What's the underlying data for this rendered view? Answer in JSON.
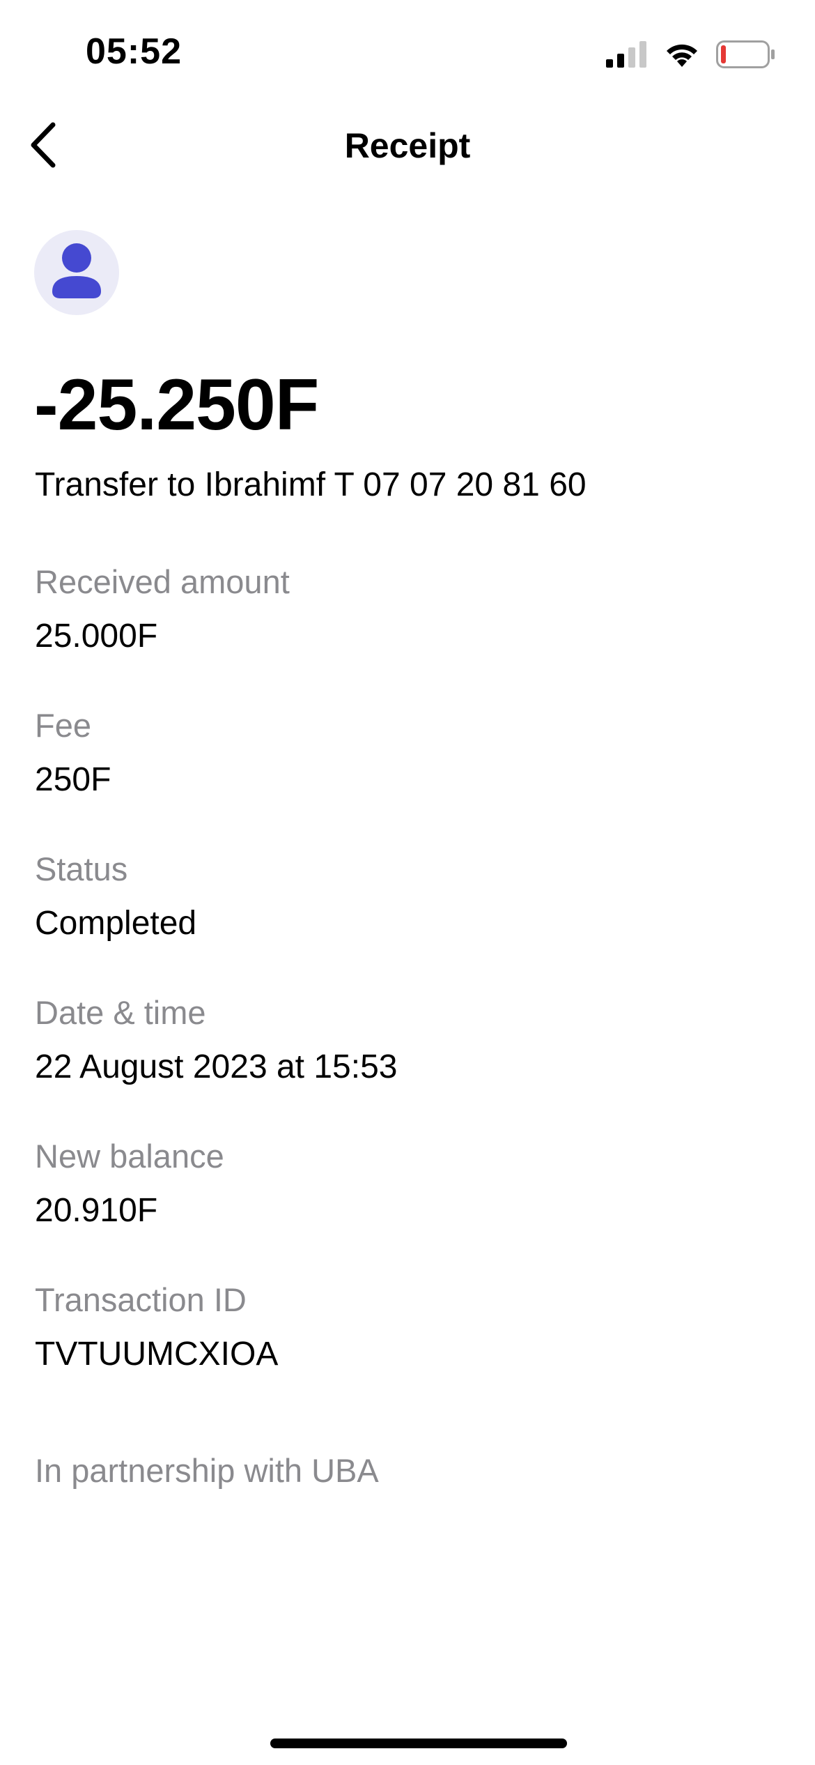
{
  "status_bar": {
    "time": "05:52",
    "signal_icon": "cellular-signal-icon",
    "wifi_icon": "wifi-icon",
    "battery_icon": "battery-low-icon",
    "battery_color": "#e53935"
  },
  "header": {
    "back_icon": "chevron-left-icon",
    "title": "Receipt"
  },
  "avatar": {
    "icon": "person-icon",
    "background": "#ebebf7",
    "color": "#4549d1"
  },
  "transaction": {
    "amount": "-25.250F",
    "description": "Transfer to Ibrahimf T 07 07 20 81 60"
  },
  "details": [
    {
      "label": "Received amount",
      "value": "25.000F"
    },
    {
      "label": "Fee",
      "value": "250F"
    },
    {
      "label": "Status",
      "value": "Completed"
    },
    {
      "label": "Date & time",
      "value": "22 August 2023 at 15:53"
    },
    {
      "label": "New balance",
      "value": "20.910F"
    },
    {
      "label": "Transaction ID",
      "value": "TVTUUMCXIOA"
    }
  ],
  "footer": {
    "partnership": "In partnership with UBA"
  }
}
